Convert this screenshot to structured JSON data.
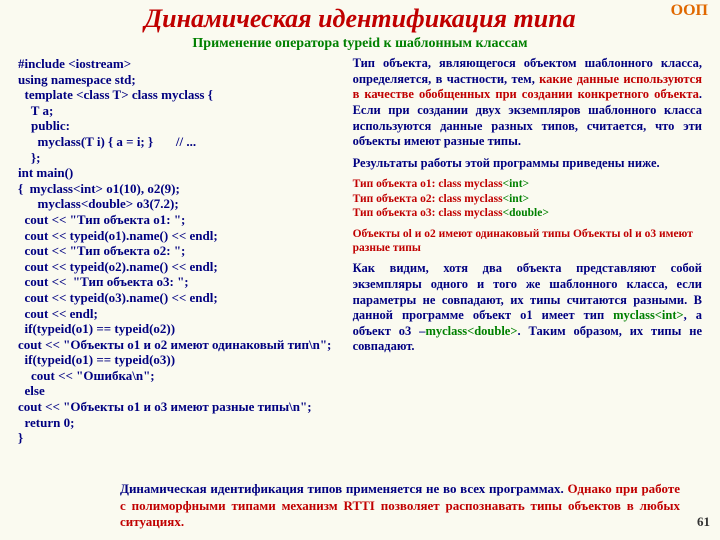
{
  "tag": "ООП",
  "title": "Динамическая идентификация типа",
  "subtitle": "Применение оператора typeid к шаблонным классам",
  "code": {
    "l1": "#include <iostream>",
    "l2": "using namespace std;",
    "l3": "  template <class T> class myclass {",
    "l4": "    T a;",
    "l5": "    public:",
    "l6": "      myclass(T i) { a = i; }       // ...",
    "l7": "    };",
    "l8": "int main()",
    "l9": "{  myclass<int> o1(10), o2(9);",
    "l10": "      myclass<double> o3(7.2);",
    "l11": "  cout << \"Тип объекта o1: \";",
    "l12": "  cout << typeid(o1).name() << endl;",
    "l13": "  cout << \"Тип объекта o2: \";",
    "l14": "  cout << typeid(o2).name() << endl;",
    "l15": "  cout <<  \"Тип объекта o3: \";",
    "l16": "  cout << typeid(o3).name() << endl;",
    "l17": "  cout << endl;",
    "l18": "  if(typeid(o1) == typeid(o2))",
    "l19": "           cout << \"Объекты o1 и o2 имеют одинаковый тип\\n\";",
    "l20": "  if(typeid(o1) == typeid(o3))",
    "l21": "    cout << \"Ошибка\\n\";",
    "l22": "  else",
    "l23": "    cout << \"Объекты o1 и o3 имеют разные типы\\n\";",
    "l24": "  return 0;",
    "l25": "}"
  },
  "right": {
    "p1a": "Тип объекта, являющегося объектом шаблонного класса, определяется, в частности, тем, ",
    "p1b": "какие данные используются в качестве обобщенных при создании конкретного объекта",
    "p1c": ". Если при создании двух экземпляров шаблонного класса используются данные разных типов, считается, что эти объекты имеют разные типы.",
    "p2": "Результаты работы этой программы приведены ниже.",
    "r1a": "Тип объекта o1: class myclass",
    "r1b": "<int>",
    "r2a": "Тип объекта o2: class myclass",
    "r2b": "<int>",
    "r3a": "Тип объекта o3: class myclass",
    "r3b": "<double>",
    "p3": "Объекты ol и o2 имеют одинаковый типы Объекты ol и o3 имеют разные типы",
    "p4a": "Как видим, хотя два объекта представляют собой экземпляры одного и того же шаблонного класса, если параметры не совпадают, их типы считаются разными. В данной программе объект o1 имеет тип ",
    "p4b": "myclass<int>",
    "p4c": ", а объект o3 –",
    "p4d": "myclass<double>",
    "p4e": ". Таким образом, их типы не совпадают."
  },
  "footer": {
    "a": "Динамическая идентификация типов применяется не во всех программах. ",
    "b": "Однако при работе с полиморфными типами механизм RTTI позволяет распознавать типы объектов в любых ситуациях."
  },
  "pagenum": "61"
}
